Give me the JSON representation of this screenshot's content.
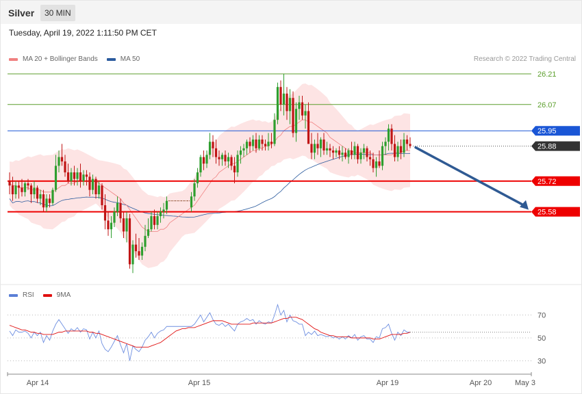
{
  "header": {
    "symbol": "Silver",
    "interval": "30 MIN"
  },
  "timestamp": "Tuesday, April 19, 2022 1:11:50 PM CET",
  "legend_main": [
    {
      "label": "MA 20 + Bollinger Bands",
      "color": "#f08080"
    },
    {
      "label": "MA 50",
      "color": "#2b5b9e"
    }
  ],
  "credit": "Research © 2022 Trading Central",
  "legend_rsi": [
    {
      "label": "RSI",
      "color": "#5b7fd6"
    },
    {
      "label": "9MA",
      "color": "#e01010"
    }
  ],
  "colors": {
    "up": "#2e9e2e",
    "down": "#c01515",
    "band": "#fde4e4",
    "ma20": "#f08080",
    "ma50": "#2b5b9e",
    "target": "#5b9e2b",
    "pivot": "#1a56d6",
    "support": "#ee0000",
    "arrow": "#2f5a93"
  },
  "chart_data": [
    {
      "type": "candlestick",
      "instrument": "Silver",
      "timeframe": "30 MIN",
      "price_ylim": [
        25.3,
        26.3
      ],
      "x_tick_labels": [
        "Apr 14",
        "Apr 15",
        "Apr 19",
        "Apr 20",
        "May 3"
      ],
      "last_price": 25.88,
      "levels": [
        {
          "value": 26.21,
          "label": "26.21",
          "kind": "target"
        },
        {
          "value": 26.07,
          "label": "26.07",
          "kind": "target"
        },
        {
          "value": 25.95,
          "label": "25.95",
          "kind": "pivot"
        },
        {
          "value": 25.72,
          "label": "25.72",
          "kind": "support"
        },
        {
          "value": 25.58,
          "label": "25.58",
          "kind": "support"
        }
      ],
      "last_price_label": "25.88",
      "forecast": {
        "from": 25.88,
        "to": 25.58,
        "direction": "down"
      },
      "ohlc": [
        [
          25.72,
          25.76,
          25.66,
          25.7
        ],
        [
          25.7,
          25.74,
          25.63,
          25.66
        ],
        [
          25.66,
          25.72,
          25.64,
          25.7
        ],
        [
          25.7,
          25.72,
          25.64,
          25.69
        ],
        [
          25.69,
          25.73,
          25.65,
          25.67
        ],
        [
          25.67,
          25.72,
          25.65,
          25.71
        ],
        [
          25.71,
          25.73,
          25.68,
          25.7
        ],
        [
          25.7,
          25.71,
          25.62,
          25.66
        ],
        [
          25.66,
          25.72,
          25.64,
          25.69
        ],
        [
          25.69,
          25.7,
          25.62,
          25.64
        ],
        [
          25.64,
          25.68,
          25.61,
          25.66
        ],
        [
          25.66,
          25.68,
          25.58,
          25.6
        ],
        [
          25.6,
          25.66,
          25.58,
          25.64
        ],
        [
          25.64,
          25.66,
          25.6,
          25.62
        ],
        [
          25.62,
          25.69,
          25.61,
          25.68
        ],
        [
          25.68,
          25.84,
          25.67,
          25.79
        ],
        [
          25.79,
          25.86,
          25.76,
          25.83
        ],
        [
          25.83,
          25.89,
          25.79,
          25.81
        ],
        [
          25.81,
          25.84,
          25.74,
          25.76
        ],
        [
          25.76,
          25.8,
          25.71,
          25.72
        ],
        [
          25.72,
          25.78,
          25.7,
          25.76
        ],
        [
          25.76,
          25.79,
          25.7,
          25.73
        ],
        [
          25.73,
          25.78,
          25.7,
          25.76
        ],
        [
          25.76,
          25.8,
          25.69,
          25.72
        ],
        [
          25.72,
          25.77,
          25.7,
          25.75
        ],
        [
          25.75,
          25.77,
          25.7,
          25.74
        ],
        [
          25.74,
          25.76,
          25.65,
          25.68
        ],
        [
          25.68,
          25.75,
          25.66,
          25.73
        ],
        [
          25.73,
          25.74,
          25.64,
          25.66
        ],
        [
          25.66,
          25.72,
          25.64,
          25.7
        ],
        [
          25.7,
          25.71,
          25.59,
          25.61
        ],
        [
          25.61,
          25.66,
          25.5,
          25.54
        ],
        [
          25.54,
          25.58,
          25.47,
          25.5
        ],
        [
          25.5,
          25.56,
          25.46,
          25.53
        ],
        [
          25.53,
          25.6,
          25.51,
          25.58
        ],
        [
          25.58,
          25.65,
          25.56,
          25.62
        ],
        [
          25.62,
          25.64,
          25.53,
          25.55
        ],
        [
          25.55,
          25.58,
          25.46,
          25.49
        ],
        [
          25.49,
          25.58,
          25.44,
          25.55
        ],
        [
          25.55,
          25.57,
          25.32,
          25.34
        ],
        [
          25.34,
          25.45,
          25.3,
          25.43
        ],
        [
          25.43,
          25.48,
          25.37,
          25.4
        ],
        [
          25.4,
          25.46,
          25.36,
          25.38
        ],
        [
          25.38,
          25.44,
          25.36,
          25.42
        ],
        [
          25.42,
          25.52,
          25.4,
          25.47
        ],
        [
          25.47,
          25.55,
          25.46,
          25.5
        ],
        [
          25.5,
          25.58,
          25.49,
          25.56
        ],
        [
          25.56,
          25.59,
          25.5,
          25.52
        ],
        [
          25.52,
          25.58,
          25.5,
          25.56
        ],
        [
          25.56,
          25.6,
          25.53,
          25.58
        ],
        [
          25.58,
          25.62,
          25.55,
          25.59
        ],
        [
          25.59,
          25.65,
          25.57,
          25.63
        ],
        [
          25.63,
          25.64,
          25.62,
          25.63
        ],
        [
          25.63,
          25.64,
          25.62,
          25.63
        ],
        [
          25.63,
          25.64,
          25.62,
          25.63
        ],
        [
          25.63,
          25.64,
          25.62,
          25.63
        ],
        [
          25.63,
          25.64,
          25.62,
          25.63
        ],
        [
          25.63,
          25.64,
          25.62,
          25.63
        ],
        [
          25.63,
          25.64,
          25.62,
          25.63
        ],
        [
          25.6,
          25.67,
          25.58,
          25.65
        ],
        [
          25.65,
          25.73,
          25.63,
          25.71
        ],
        [
          25.71,
          25.78,
          25.69,
          25.76
        ],
        [
          25.76,
          25.84,
          25.74,
          25.83
        ],
        [
          25.83,
          25.86,
          25.77,
          25.8
        ],
        [
          25.8,
          25.86,
          25.78,
          25.84
        ],
        [
          25.84,
          25.94,
          25.82,
          25.9
        ],
        [
          25.9,
          25.93,
          25.83,
          25.87
        ],
        [
          25.87,
          25.91,
          25.8,
          25.83
        ],
        [
          25.83,
          25.86,
          25.79,
          25.82
        ],
        [
          25.82,
          25.85,
          25.79,
          25.84
        ],
        [
          25.84,
          25.86,
          25.79,
          25.81
        ],
        [
          25.81,
          25.85,
          25.78,
          25.83
        ],
        [
          25.83,
          25.84,
          25.77,
          25.79
        ],
        [
          25.79,
          25.83,
          25.71,
          25.76
        ],
        [
          25.76,
          25.86,
          25.74,
          25.84
        ],
        [
          25.84,
          25.88,
          25.8,
          25.86
        ],
        [
          25.86,
          25.89,
          25.83,
          25.87
        ],
        [
          25.87,
          25.91,
          25.84,
          25.9
        ],
        [
          25.9,
          25.92,
          25.85,
          25.88
        ],
        [
          25.88,
          25.93,
          25.86,
          25.91
        ],
        [
          25.91,
          25.94,
          25.85,
          25.87
        ],
        [
          25.87,
          25.93,
          25.86,
          25.91
        ],
        [
          25.91,
          25.93,
          25.86,
          25.89
        ],
        [
          25.89,
          25.91,
          25.86,
          25.88
        ],
        [
          25.88,
          25.94,
          25.86,
          25.9
        ],
        [
          25.9,
          25.94,
          25.87,
          25.89
        ],
        [
          25.89,
          26.03,
          25.88,
          26.0
        ],
        [
          26.0,
          26.17,
          25.98,
          26.15
        ],
        [
          26.15,
          26.18,
          26.04,
          26.07
        ],
        [
          26.07,
          26.21,
          26.02,
          26.12
        ],
        [
          26.12,
          26.15,
          26.0,
          26.04
        ],
        [
          26.04,
          26.14,
          25.98,
          26.1
        ],
        [
          26.1,
          26.13,
          25.92,
          25.94
        ],
        [
          25.94,
          26.08,
          25.9,
          26.05
        ],
        [
          26.05,
          26.11,
          26.0,
          26.08
        ],
        [
          26.08,
          26.11,
          26.0,
          26.02
        ],
        [
          26.02,
          26.07,
          25.96,
          26.04
        ],
        [
          26.04,
          26.08,
          25.92,
          25.89
        ],
        [
          25.89,
          25.94,
          25.82,
          25.85
        ],
        [
          25.85,
          25.91,
          25.82,
          25.89
        ],
        [
          25.89,
          25.94,
          25.84,
          25.87
        ],
        [
          25.87,
          25.92,
          25.83,
          25.91
        ],
        [
          25.91,
          25.94,
          25.84,
          25.86
        ],
        [
          25.86,
          25.9,
          25.84,
          25.87
        ],
        [
          25.87,
          25.89,
          25.83,
          25.86
        ],
        [
          25.86,
          25.88,
          25.82,
          25.85
        ],
        [
          25.85,
          25.87,
          25.83,
          25.86
        ],
        [
          25.86,
          25.88,
          25.82,
          25.84
        ],
        [
          25.84,
          25.88,
          25.81,
          25.85
        ],
        [
          25.85,
          25.87,
          25.82,
          25.83
        ],
        [
          25.83,
          25.87,
          25.8,
          25.86
        ],
        [
          25.86,
          25.9,
          25.82,
          25.84
        ],
        [
          25.84,
          25.9,
          25.82,
          25.88
        ],
        [
          25.88,
          25.89,
          25.8,
          25.82
        ],
        [
          25.82,
          25.87,
          25.8,
          25.85
        ],
        [
          25.85,
          25.89,
          25.82,
          25.87
        ],
        [
          25.87,
          25.88,
          25.81,
          25.83
        ],
        [
          25.83,
          25.86,
          25.79,
          25.82
        ],
        [
          25.82,
          25.85,
          25.76,
          25.78
        ],
        [
          25.78,
          25.83,
          25.74,
          25.81
        ],
        [
          25.81,
          25.86,
          25.78,
          25.79
        ],
        [
          25.79,
          25.9,
          25.77,
          25.88
        ],
        [
          25.88,
          25.92,
          25.84,
          25.9
        ],
        [
          25.9,
          25.98,
          25.86,
          25.96
        ],
        [
          25.96,
          25.98,
          25.86,
          25.89
        ],
        [
          25.89,
          25.93,
          25.81,
          25.83
        ],
        [
          25.83,
          25.9,
          25.81,
          25.88
        ],
        [
          25.88,
          25.91,
          25.82,
          25.85
        ],
        [
          25.85,
          25.94,
          25.83,
          25.91
        ],
        [
          25.91,
          25.93,
          25.86,
          25.89
        ],
        [
          25.89,
          25.92,
          25.87,
          25.88
        ]
      ],
      "ma20": [
        25.71,
        25.7,
        25.7,
        25.69,
        25.69,
        25.69,
        25.69,
        25.68,
        25.68,
        25.68,
        25.68,
        25.67,
        25.67,
        25.67,
        25.67,
        25.68,
        25.69,
        25.7,
        25.7,
        25.71,
        25.71,
        25.71,
        25.72,
        25.72,
        25.72,
        25.72,
        25.72,
        25.72,
        25.72,
        25.71,
        25.7,
        25.69,
        25.68,
        25.67,
        25.66,
        25.65,
        25.64,
        25.62,
        25.61,
        25.59,
        25.57,
        25.55,
        25.53,
        25.51,
        25.5,
        25.49,
        25.49,
        25.49,
        25.49,
        25.5,
        25.5,
        25.51,
        25.53,
        25.54,
        25.55,
        25.56,
        25.57,
        25.58,
        25.59,
        25.6,
        25.61,
        25.63,
        25.65,
        25.67,
        25.69,
        25.71,
        25.73,
        25.74,
        25.76,
        25.77,
        25.78,
        25.79,
        25.8,
        25.8,
        25.81,
        25.82,
        25.83,
        25.84,
        25.85,
        25.86,
        25.86,
        25.87,
        25.87,
        25.88,
        25.88,
        25.89,
        25.9,
        25.92,
        25.93,
        25.95,
        25.96,
        25.97,
        25.97,
        25.98,
        25.99,
        26.0,
        26.0,
        25.99,
        25.99,
        25.98,
        25.97,
        25.96,
        25.95,
        25.94,
        25.92,
        25.91,
        25.9,
        25.89,
        25.88,
        25.87,
        25.86,
        25.86,
        25.85,
        25.85,
        25.85,
        25.85,
        25.85,
        25.85,
        25.84,
        25.84,
        25.84,
        25.84,
        25.84,
        25.84,
        25.84,
        25.85,
        25.85,
        25.85,
        25.86,
        25.86,
        25.86
      ],
      "rsi_ylim": [
        20,
        80
      ],
      "rsi_ticks": [
        70,
        50,
        30
      ],
      "rsi": [
        56,
        52,
        57,
        55,
        55,
        56,
        54,
        50,
        55,
        52,
        55,
        46,
        52,
        48,
        56,
        62,
        66,
        62,
        58,
        54,
        58,
        56,
        59,
        55,
        58,
        57,
        49,
        55,
        50,
        56,
        45,
        40,
        38,
        42,
        47,
        52,
        44,
        37,
        45,
        30,
        43,
        40,
        38,
        42,
        48,
        51,
        55,
        50,
        54,
        56,
        57,
        60,
        60,
        60,
        60,
        60,
        60,
        60,
        60,
        60,
        62,
        66,
        70,
        64,
        68,
        72,
        66,
        62,
        61,
        63,
        60,
        62,
        59,
        56,
        62,
        64,
        65,
        67,
        65,
        66,
        62,
        65,
        63,
        62,
        64,
        63,
        70,
        79,
        70,
        74,
        64,
        70,
        65,
        64,
        62,
        62,
        52,
        55,
        53,
        56,
        52,
        53,
        52,
        51,
        52,
        50,
        51,
        49,
        51,
        49,
        52,
        50,
        53,
        48,
        51,
        52,
        49,
        49,
        46,
        51,
        50,
        58,
        59,
        62,
        54,
        48,
        55,
        52,
        57,
        55,
        55
      ],
      "rsi_ma9": [
        61,
        60,
        59,
        58,
        57,
        57,
        56,
        55,
        55,
        54,
        54,
        53,
        53,
        53,
        53,
        54,
        55,
        55,
        56,
        56,
        56,
        56,
        56,
        56,
        56,
        56,
        55,
        55,
        54,
        54,
        53,
        52,
        51,
        50,
        49,
        48,
        47,
        46,
        45,
        44,
        43,
        42,
        42,
        42,
        42,
        42,
        43,
        44,
        45,
        46,
        48,
        50,
        52,
        54,
        56,
        57,
        58,
        58,
        59,
        59,
        59,
        60,
        61,
        62,
        63,
        64,
        65,
        65,
        65,
        65,
        64,
        63,
        62,
        62,
        62,
        62,
        62,
        62,
        62,
        63,
        63,
        63,
        63,
        63,
        63,
        63,
        64,
        65,
        66,
        67,
        67,
        68,
        68,
        68,
        67,
        66,
        64,
        62,
        60,
        58,
        57,
        55,
        54,
        53,
        52,
        52,
        51,
        51,
        51,
        51,
        51,
        50,
        50,
        50,
        50,
        50,
        50,
        50,
        49,
        49,
        49,
        50,
        51,
        52,
        53,
        53,
        53,
        53,
        54,
        54,
        55
      ]
    }
  ]
}
